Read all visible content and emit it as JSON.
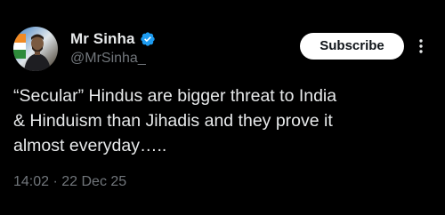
{
  "author": {
    "display_name": "Mr Sinha",
    "handle": "@MrSinha_",
    "verified_icon": "verified-badge-icon",
    "verified_color": "#1d9bf0"
  },
  "actions": {
    "subscribe_label": "Subscribe",
    "more_icon": "vertical-dots-icon"
  },
  "tweet": {
    "text_lines": [
      "“Secular” Hindus are bigger threat to India",
      "& Hinduism than Jihadis and they prove it",
      "almost everyday….."
    ],
    "timestamp": "14:02 · 22 Dec 25"
  },
  "colors": {
    "background": "#000000",
    "text": "#e7e9ea",
    "secondary_text": "#71767b",
    "button_bg": "#ffffff",
    "button_text": "#0f1419"
  }
}
